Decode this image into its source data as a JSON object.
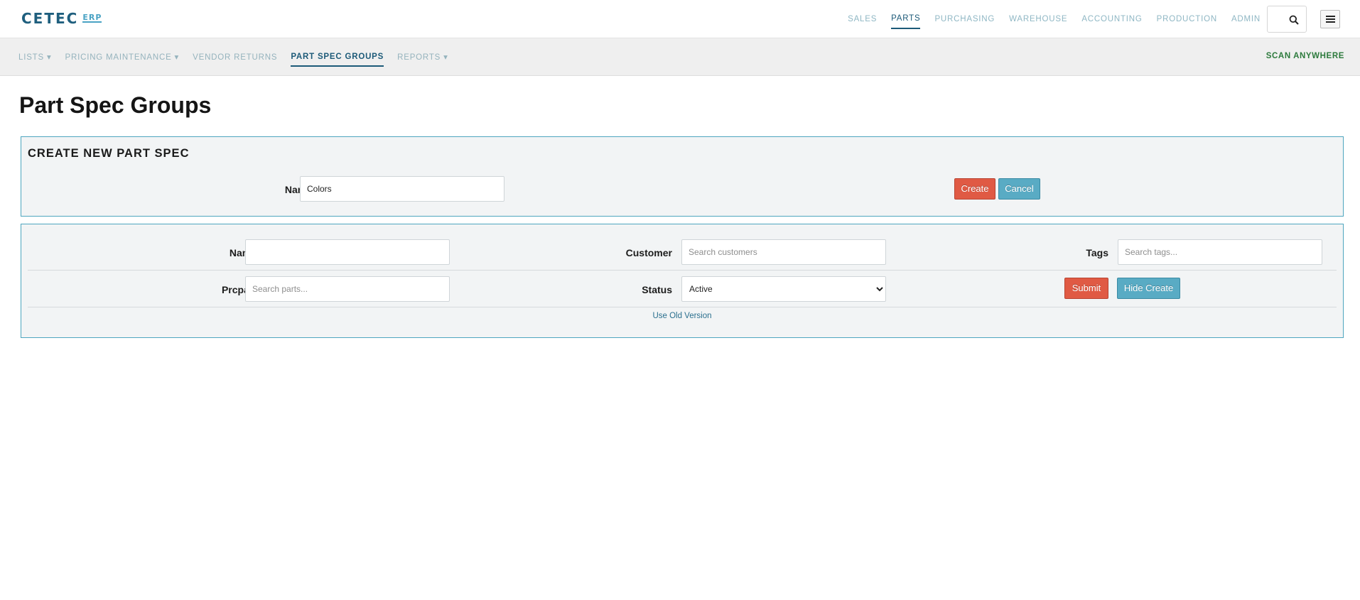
{
  "brand": {
    "name": "CETEC",
    "suffix": "ERP"
  },
  "top_nav": [
    "SALES",
    "PARTS",
    "PURCHASING",
    "WAREHOUSE",
    "ACCOUNTING",
    "PRODUCTION",
    "ADMIN"
  ],
  "top_nav_active": "PARTS",
  "sub_nav": [
    "LISTS ▾",
    "PRICING MAINTENANCE ▾",
    "VENDOR RETURNS",
    "PART SPEC GROUPS",
    "REPORTS ▾"
  ],
  "sub_nav_active": "PART SPEC GROUPS",
  "scan_anywhere": "SCAN ANYWHERE",
  "page_title": "Part Spec Groups",
  "create_panel": {
    "heading": "CREATE NEW PART SPEC",
    "name_label": "Name",
    "name_value": "Colors",
    "create_label": "Create",
    "cancel_label": "Cancel"
  },
  "search_panel": {
    "name_label": "Name",
    "name_value": "",
    "customer_label": "Customer",
    "customer_placeholder": "Search customers",
    "tags_label": "Tags",
    "tags_placeholder": "Search tags...",
    "prcpart_label": "Prcpart",
    "prcpart_placeholder": "Search parts...",
    "status_label": "Status",
    "status_value": "Active",
    "submit_label": "Submit",
    "hide_create_label": "Hide Create",
    "old_version_link": "Use Old Version"
  },
  "colors": {
    "brand": "#1f5f7e",
    "accent": "#59abc4",
    "danger": "#e05a44",
    "panel_border": "#4ea6bf",
    "scan": "#2c7a3c"
  }
}
